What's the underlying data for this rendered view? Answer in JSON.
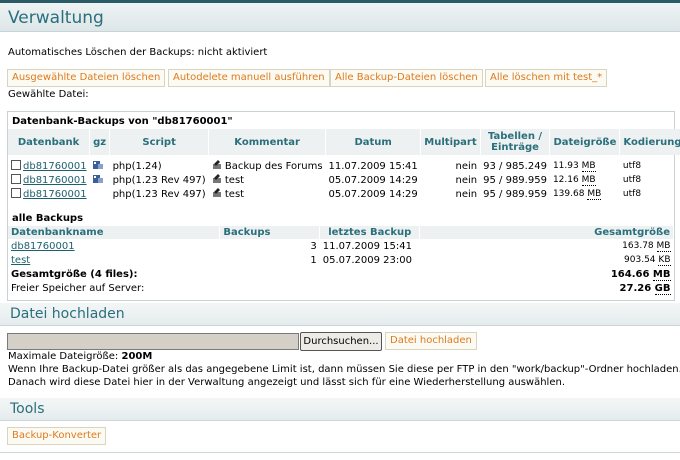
{
  "page": {
    "title": "Verwaltung"
  },
  "autodelete_status": "Automatisches Löschen der Backups: nicht aktiviert",
  "actions": [
    {
      "label": "Ausgewählte Dateien löschen"
    },
    {
      "label": "Autodelete manuell ausführen"
    },
    {
      "label": "Alle Backup-Dateien löschen"
    },
    {
      "label": "Alle löschen mit test_*"
    }
  ],
  "selected_file_label": "Gewählte Datei:",
  "db_backups": {
    "title": "Datenbank-Backups von \"db81760001\"",
    "headers": {
      "db": "Datenbank",
      "gz": "gz",
      "script": "Script",
      "comment": "Kommentar",
      "date": "Datum",
      "multipart": "Multipart",
      "tables1": "Tabellen /",
      "tables2": "Einträge",
      "size": "Dateigröße",
      "encoding": "Kodierung"
    },
    "rows": [
      {
        "db": "db81760001",
        "script": "php(1.24)",
        "comment": "Backup des Forums",
        "date": "11.07.2009 15:41",
        "multipart": "nein",
        "tables": "93 / 985.249",
        "size": "11.93",
        "unit": "MB",
        "encoding": "utf8"
      },
      {
        "db": "db81760001",
        "script": "php(1.23 Rev 497)",
        "comment": "test",
        "date": "05.07.2009 14:29",
        "multipart": "nein",
        "tables": "95 / 989.959",
        "size": "12.16",
        "unit": "MB",
        "encoding": "utf8"
      },
      {
        "db": "db81760001",
        "script": "php(1.23 Rev 497)",
        "comment": "test",
        "date": "05.07.2009 14:29",
        "multipart": "nein",
        "tables": "95 / 989.959",
        "size": "139.68",
        "unit": "MB",
        "encoding": "utf8"
      }
    ]
  },
  "all_backups": {
    "title": "alle Backups",
    "headers": {
      "name": "Datenbankname",
      "backups": "Backups",
      "last": "letztes Backup",
      "total": "Gesamtgröße"
    },
    "rows": [
      {
        "name": "db81760001",
        "backups": "3",
        "last": "11.07.2009 15:41",
        "total": "163.78",
        "unit": "MB"
      },
      {
        "name": "test",
        "backups": "1",
        "last": "05.07.2009 23:00",
        "total": "903.54",
        "unit": "KB"
      }
    ],
    "sum_label": "Gesamtgröße (4 files):",
    "sum_value": "164.66",
    "sum_unit": "MB",
    "free_label": "Freier Speicher auf Server:",
    "free_value": "27.26",
    "free_unit": "GB"
  },
  "upload": {
    "title": "Datei hochladen",
    "browse_label": "Durchsuchen...",
    "upload_label": "Datei hochladen",
    "max_label": "Maximale Dateigröße:",
    "max_value": "200M",
    "info1": "Wenn Ihre Backup-Datei größer als das angegebene Limit ist, dann müssen Sie diese per FTP in den \"work/backup\"-Ordner hochladen.",
    "info2": "Danach wird diese Datei hier in der Verwaltung angezeigt und lässt sich für eine Wiederherstellung auswählen."
  },
  "tools": {
    "title": "Tools",
    "converter_label": "Backup-Konverter"
  },
  "icons": {
    "gz": "archive-icon",
    "script": "script-icon"
  },
  "colors": {
    "accent": "#2a6f7c",
    "button_text": "#e07a1e",
    "header_bg": "#eef1f1"
  }
}
